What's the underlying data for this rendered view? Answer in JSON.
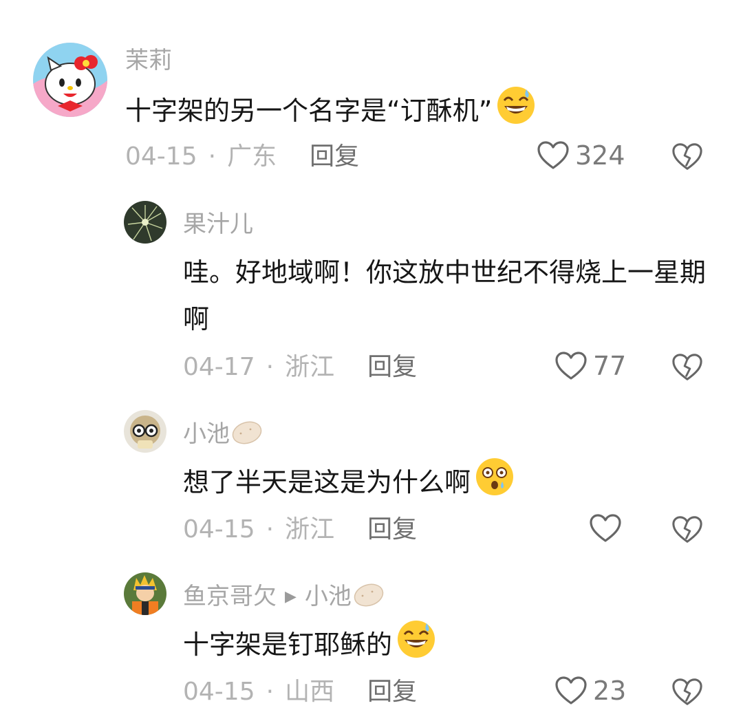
{
  "comments": [
    {
      "username": "茉莉",
      "text": "十字架的另一个名字是“订酥机”",
      "emoji": "grinning-sweat-emoji",
      "date": "04-15",
      "location": "广东",
      "reply_label": "回复",
      "likes": "324"
    },
    {
      "username": "果汁儿",
      "text": "哇。好地域啊！你这放中世纪不得烧上一星期啊",
      "date": "04-17",
      "location": "浙江",
      "reply_label": "回复",
      "likes": "77"
    },
    {
      "username": "小池",
      "text": "想了半天是这是为什么啊",
      "emoji": "dizzy-face-emoji",
      "date": "04-15",
      "location": "浙江",
      "reply_label": "回复",
      "likes": ""
    },
    {
      "username": "鱼京哥欠",
      "reply_to": "小池",
      "text": "十字架是钉耶稣的",
      "emoji": "grinning-sweat-emoji",
      "date": "04-15",
      "location": "山西",
      "reply_label": "回复",
      "likes": "23"
    }
  ],
  "meta_separator": "·",
  "colors": {
    "username": "#a6a6a6",
    "text": "#161616",
    "meta": "#b3b3b3",
    "reply": "#6f6f6f"
  }
}
